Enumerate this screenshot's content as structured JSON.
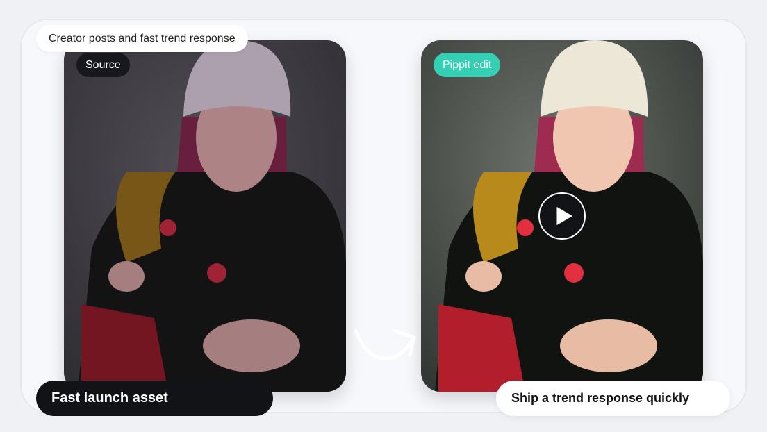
{
  "header": {
    "caption": "Creator posts and fast trend response"
  },
  "source_panel": {
    "tag": "Source",
    "footer_label": "Fast launch asset"
  },
  "edit_panel": {
    "tag": "Pippit edit",
    "footer_label": "Ship a trend response quickly"
  },
  "icons": {
    "play": "play-icon",
    "transform": "curved-arrow-icon"
  },
  "colors": {
    "accent": "#35cfb4",
    "dark_pill": "#121317",
    "card_bg": "#f7f8fb"
  }
}
